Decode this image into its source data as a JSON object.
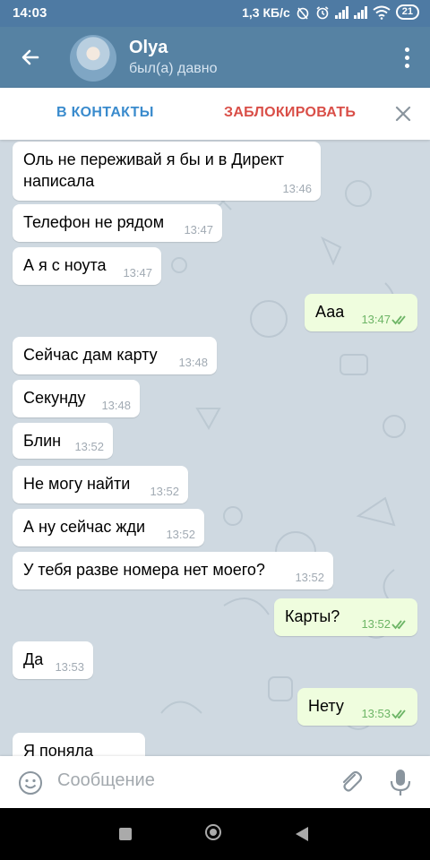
{
  "status_bar": {
    "time": "14:03",
    "network_speed": "1,3 КБ/с",
    "battery": "21"
  },
  "header": {
    "contact_name": "Olya",
    "contact_status": "был(а) давно"
  },
  "action_bar": {
    "add_contact": "В КОНТАКТЫ",
    "block": "ЗАБЛОКИРОВАТЬ"
  },
  "messages": [
    {
      "direction": "in",
      "text": "Оль не переживай я бы и в Директ",
      "text2": "написала",
      "time": "13:46"
    },
    {
      "direction": "in",
      "text": "Телефон не рядом",
      "time": "13:47"
    },
    {
      "direction": "in",
      "text": "А я с ноута",
      "time": "13:47"
    },
    {
      "direction": "out",
      "text": "Ааа",
      "time": "13:47",
      "read": true
    },
    {
      "direction": "in",
      "text": "Сейчас дам карту",
      "time": "13:48"
    },
    {
      "direction": "in",
      "text": "Секунду",
      "time": "13:48"
    },
    {
      "direction": "in",
      "text": "Блин",
      "time": "13:52"
    },
    {
      "direction": "in",
      "text": "Не могу найти",
      "time": "13:52"
    },
    {
      "direction": "in",
      "text": "А ну сейчас жди",
      "time": "13:52"
    },
    {
      "direction": "in",
      "text": "У тебя разве номера нет моего?",
      "time": "13:52"
    },
    {
      "direction": "out",
      "text": "Карты?",
      "time": "13:52",
      "read": true
    },
    {
      "direction": "in",
      "text": "Да",
      "time": "13:53"
    },
    {
      "direction": "out",
      "text": "Нету",
      "time": "13:53",
      "read": true
    },
    {
      "direction": "in",
      "text": "Я поняла",
      "time": ""
    }
  ],
  "input": {
    "placeholder": "Сообщение"
  },
  "icons": {
    "back": "arrow-left-icon",
    "menu": "more-vert-icon",
    "close": "close-icon",
    "emoji": "emoji-icon",
    "attach": "paperclip-icon",
    "mic": "microphone-icon",
    "read_receipt": "double-check-icon"
  },
  "colors": {
    "app_bar": "#5682a3",
    "status_bar": "#4e7aa3",
    "chat_background": "#cfd9e1",
    "incoming_bubble": "#ffffff",
    "outgoing_bubble": "#effdde",
    "link_blue": "#3a8bcd",
    "block_red": "#d94e47",
    "read_check": "#6db566"
  }
}
